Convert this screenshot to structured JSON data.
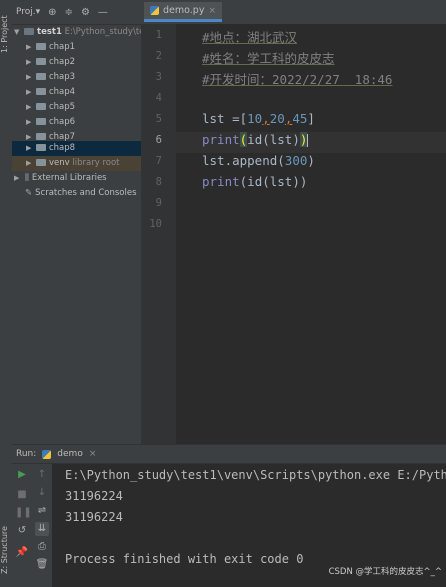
{
  "left_strip": {
    "project_tab": "1: Project",
    "structure_tab": "Z: Structure"
  },
  "project_panel": {
    "header_label": "Proj.▾",
    "tree": [
      {
        "label": "test1",
        "detail": "E:\\Python_study\\te",
        "expanded": true,
        "level": 0
      },
      {
        "label": "chap1",
        "level": 1
      },
      {
        "label": "chap2",
        "level": 1
      },
      {
        "label": "chap3",
        "level": 1
      },
      {
        "label": "chap4",
        "level": 1
      },
      {
        "label": "chap5",
        "level": 1
      },
      {
        "label": "chap6",
        "level": 1
      },
      {
        "label": "chap7",
        "level": 1
      },
      {
        "label": "chap8",
        "level": 1,
        "selected": true
      },
      {
        "label": "venv",
        "detail": "library root",
        "level": 1
      },
      {
        "label": "External Libraries",
        "level": 0
      },
      {
        "label": "Scratches and Consoles",
        "level": 0
      }
    ]
  },
  "editor": {
    "tab_label": "demo.py",
    "current_line": 6,
    "line_numbers": [
      "1",
      "2",
      "3",
      "4",
      "5",
      "6",
      "7",
      "8",
      "9",
      "10"
    ],
    "lines": {
      "l1": "#地点：湖北武汉",
      "l2": "#姓名：学工科的皮皮志",
      "l3": "#开发时间：2022/2/27  18:46",
      "l5_a": "lst =[",
      "l5_n1": "10",
      "l5_c1": ",",
      "l5_n2": "20",
      "l5_c2": ",",
      "l5_n3": "45",
      "l5_b": "]",
      "l6_kw": "print",
      "l6_lp": "(",
      "l6_mid": "id(lst)",
      "l6_rp": ")",
      "l7_a": "lst.append(",
      "l7_n": "300",
      "l7_b": ")",
      "l8_kw": "print",
      "l8_rest": "(id(lst))"
    }
  },
  "run_panel": {
    "label": "Run:",
    "config_name": "demo",
    "output": [
      "E:\\Python_study\\test1\\venv\\Scripts\\python.exe E:/Pytho",
      "31196224",
      "31196224",
      "",
      "Process finished with exit code 0"
    ]
  },
  "watermark": "CSDN @学工科的皮皮志^_^",
  "colors": {
    "selection": "#0d293e",
    "tab_underline": "#4a88c7",
    "run_green": "#499c54"
  }
}
